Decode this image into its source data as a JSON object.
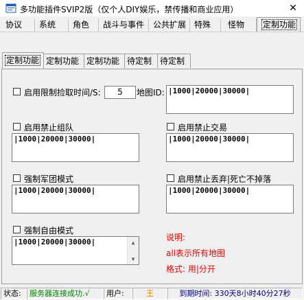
{
  "window": {
    "title": "多功能插件SVIP2版（仅个人DIY娱乐，禁传播和商业应用）",
    "close_label": "✕"
  },
  "top_tabs": [
    {
      "label": "协议"
    },
    {
      "label": "系统"
    },
    {
      "label": "角色"
    },
    {
      "label": "战斗与事件"
    },
    {
      "label": "公共扩展"
    },
    {
      "label": "特殊"
    },
    {
      "label": "怪物"
    },
    {
      "label": "定制功能"
    }
  ],
  "sub_tabs": [
    {
      "label": "定制功能"
    },
    {
      "label": "定制功能"
    },
    {
      "label": "定制功能"
    },
    {
      "label": "待定制"
    },
    {
      "label": "待定制"
    }
  ],
  "settings": {
    "pickup_limit": {
      "label": "启用限制捡取时间/S:",
      "value": "5",
      "map_label": "地图ID:",
      "map_ids": "|1000|20000|30000|"
    },
    "ban_team": {
      "label": "启用禁止组队",
      "map_ids": "|1000|20000|30000|"
    },
    "ban_trade": {
      "label": "启用禁止交易",
      "map_ids": "|1000|20000|30000|"
    },
    "force_legion": {
      "label": "强制军团模式",
      "map_ids": "|1000|20000|30000|"
    },
    "ban_drop": {
      "label": "启用禁止丢弃|死亡不掉落",
      "map_ids": "|1000|20000|30000|"
    },
    "force_free": {
      "label": "强制自由模式",
      "map_ids": "|1000|20000|30000|"
    }
  },
  "notes": {
    "title": "说明:",
    "line1": "all表示所有地图",
    "line2": "格式: 用|分开"
  },
  "status": {
    "label": "状态:",
    "connection": "服务器连接成功.√",
    "user_label": "用户:",
    "user": "王",
    "expiry": "到期时间: 330天8小时40分27秒"
  },
  "colors": {
    "accent_red": "#e00000",
    "status_green": "#008000",
    "user_orange": "#e08000",
    "expiry_blue": "#000080"
  }
}
